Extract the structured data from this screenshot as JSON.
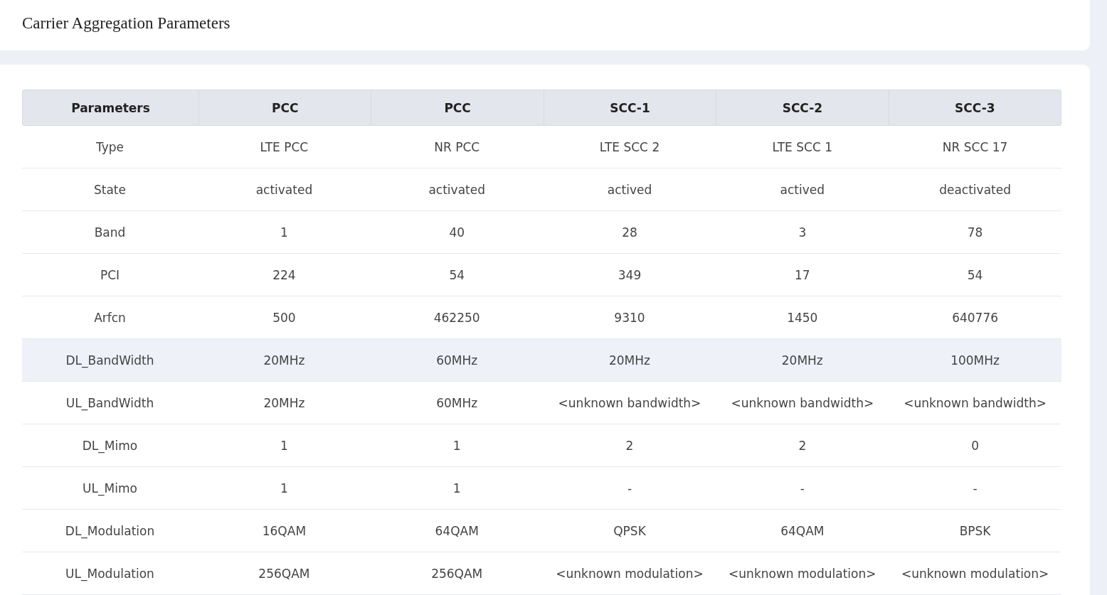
{
  "header": {
    "title": "Carrier Aggregation Parameters"
  },
  "table": {
    "columns": [
      "Parameters",
      "PCC",
      "PCC",
      "SCC-1",
      "SCC-2",
      "SCC-3"
    ],
    "rows": [
      {
        "cells": [
          "Type",
          "LTE PCC",
          "NR PCC",
          "LTE SCC 2",
          "LTE SCC 1",
          "NR SCC 17"
        ],
        "selected": false
      },
      {
        "cells": [
          "State",
          "activated",
          "activated",
          "actived",
          "actived",
          "deactivated"
        ],
        "selected": false
      },
      {
        "cells": [
          "Band",
          "1",
          "40",
          "28",
          "3",
          "78"
        ],
        "selected": false
      },
      {
        "cells": [
          "PCI",
          "224",
          "54",
          "349",
          "17",
          "54"
        ],
        "selected": false
      },
      {
        "cells": [
          "Arfcn",
          "500",
          "462250",
          "9310",
          "1450",
          "640776"
        ],
        "selected": false
      },
      {
        "cells": [
          "DL_BandWidth",
          "20MHz",
          "60MHz",
          "20MHz",
          "20MHz",
          "100MHz"
        ],
        "selected": true
      },
      {
        "cells": [
          "UL_BandWidth",
          "20MHz",
          "60MHz",
          "<unknown bandwidth>",
          "<unknown bandwidth>",
          "<unknown bandwidth>"
        ],
        "selected": false
      },
      {
        "cells": [
          "DL_Mimo",
          "1",
          "1",
          "2",
          "2",
          "0"
        ],
        "selected": false
      },
      {
        "cells": [
          "UL_Mimo",
          "1",
          "1",
          "-",
          "-",
          "-"
        ],
        "selected": false
      },
      {
        "cells": [
          "DL_Modulation",
          "16QAM",
          "64QAM",
          "QPSK",
          "64QAM",
          "BPSK"
        ],
        "selected": false
      },
      {
        "cells": [
          "UL_Modulation",
          "256QAM",
          "256QAM",
          "<unknown modulation>",
          "<unknown modulation>",
          "<unknown modulation>"
        ],
        "selected": false
      }
    ]
  }
}
